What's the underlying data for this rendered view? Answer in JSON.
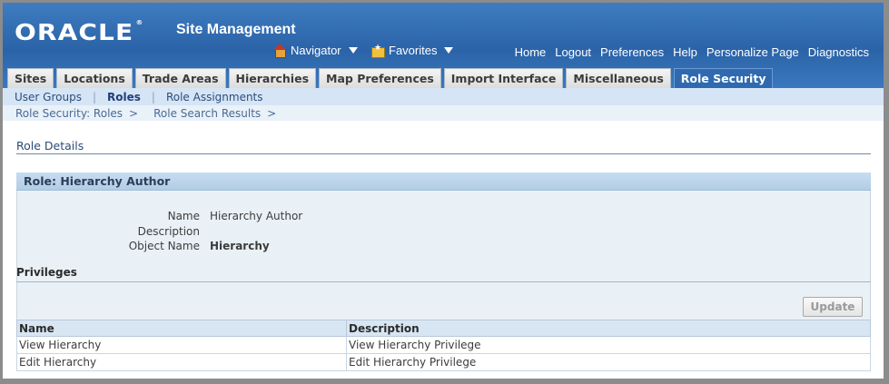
{
  "header": {
    "logo": "ORACLE",
    "app_title": "Site Management",
    "navigator": "Navigator",
    "favorites": "Favorites",
    "global_links": [
      "Home",
      "Logout",
      "Preferences",
      "Help",
      "Personalize Page",
      "Diagnostics"
    ]
  },
  "tabs": [
    {
      "label": "Sites"
    },
    {
      "label": "Locations"
    },
    {
      "label": "Trade Areas"
    },
    {
      "label": "Hierarchies"
    },
    {
      "label": "Map Preferences"
    },
    {
      "label": "Import Interface"
    },
    {
      "label": "Miscellaneous"
    },
    {
      "label": "Role Security",
      "active": true
    }
  ],
  "subnav": {
    "items": [
      "User Groups",
      "Roles",
      "Role Assignments"
    ],
    "current": "Roles"
  },
  "breadcrumb": {
    "items": [
      "Role Security: Roles",
      "Role Search Results"
    ],
    "separator": ">"
  },
  "page_title": "Role Details",
  "region": {
    "title": "Role: Hierarchy Author",
    "fields": {
      "name_label": "Name",
      "name_value": "Hierarchy Author",
      "description_label": "Description",
      "description_value": "",
      "object_label": "Object Name",
      "object_value": "Hierarchy"
    }
  },
  "privileges": {
    "title": "Privileges",
    "update_button": "Update",
    "columns": [
      "Name",
      "Description"
    ],
    "rows": [
      [
        "View Hierarchy",
        "View Hierarchy Privilege"
      ],
      [
        "Edit Hierarchy",
        "Edit Hierarchy Privilege"
      ]
    ]
  }
}
